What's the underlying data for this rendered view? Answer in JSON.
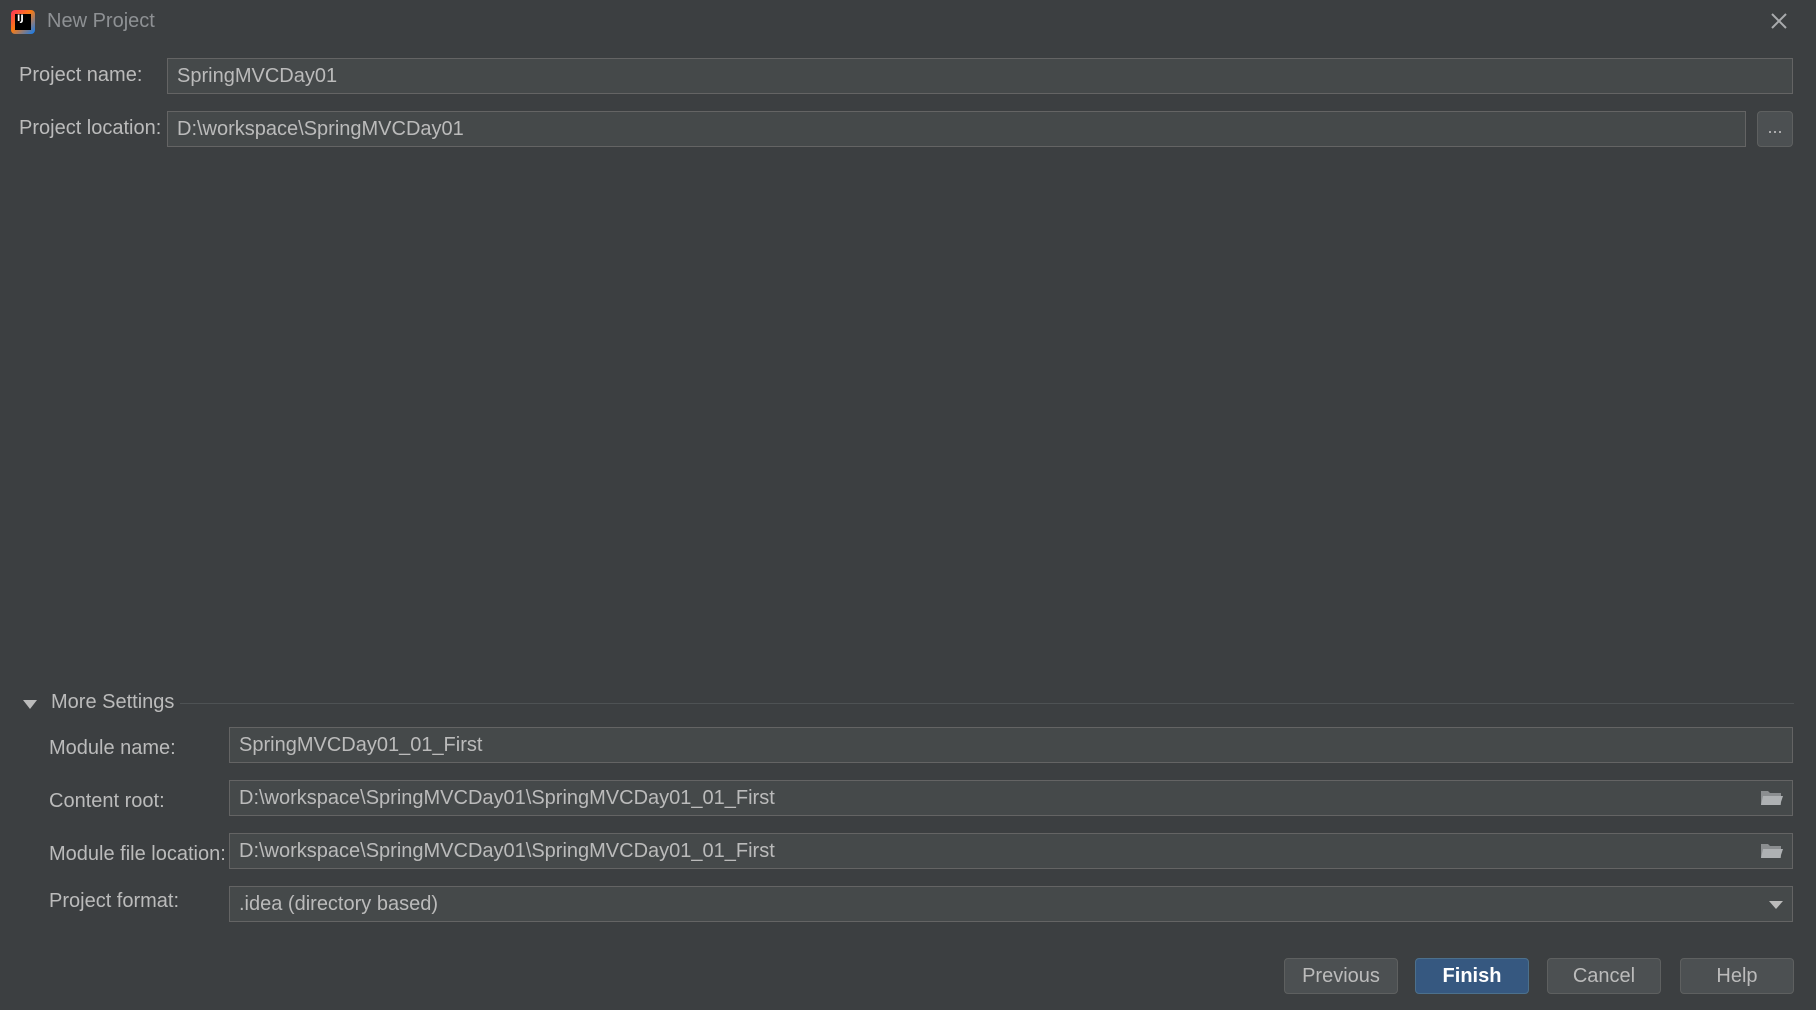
{
  "window": {
    "title": "New Project",
    "logo_text": "IJ",
    "logo_icon": "intellij-logo-icon",
    "close_icon": "close-icon"
  },
  "project": {
    "name_label": "Project name:",
    "name_value": "SpringMVCDay01",
    "location_label": "Project location:",
    "location_value": "D:\\workspace\\SpringMVCDay01",
    "browse_label": "..."
  },
  "more_settings": {
    "label": "More Settings",
    "expanded": true,
    "module_name_label": "Module name:",
    "module_name_value": "SpringMVCDay01_01_First",
    "content_root_label": "Content root:",
    "content_root_value": "D:\\workspace\\SpringMVCDay01\\SpringMVCDay01_01_First",
    "module_file_label": "Module file location:",
    "module_file_value": "D:\\workspace\\SpringMVCDay01\\SpringMVCDay01_01_First",
    "format_label": "Project format:",
    "format_value": ".idea (directory based)"
  },
  "buttons": {
    "previous": "Previous",
    "finish": "Finish",
    "cancel": "Cancel",
    "help": "Help"
  },
  "colors": {
    "background": "#3c3f41",
    "field_background": "#45494a",
    "primary_button": "#365880",
    "text": "#bbbbbb"
  }
}
